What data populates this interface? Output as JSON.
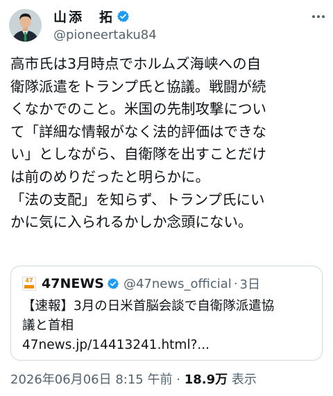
{
  "author": {
    "display_name": "山添　拓",
    "handle": "@pioneertaku84"
  },
  "tweet": {
    "lines": [
      "高市氏は3月時点でホルムズ海峡への自",
      "衛隊派遣をトランプ氏と協議。戦闘が続",
      "くなかでのこと。米国の先制攻撃につい",
      "て「詳細な情報がなく法的評価はできな",
      "い」としながら、自衛隊を出すことだけ",
      "は前のめりだったと明らかに。",
      "「法の支配」を知らず、トランプ氏にい",
      "かに気に入られるかしか念頭にない。"
    ]
  },
  "quote": {
    "logo_text": "47",
    "name": "47NEWS",
    "handle": "@47news_official",
    "separator": "·",
    "time": "3日",
    "lines": [
      "【速報】3月の日米首脳会談で自衛隊派遣協",
      "議と首相",
      "47news.jp/14413241.html?..."
    ]
  },
  "meta": {
    "timestamp": "2026年06月06日 8:15 午前",
    "separator": "·",
    "views": "18.9万",
    "views_label": "表示"
  },
  "colors": {
    "verified": "#1d9bf0",
    "logo_orange": "#f28c00",
    "secondary_text": "#536471"
  }
}
